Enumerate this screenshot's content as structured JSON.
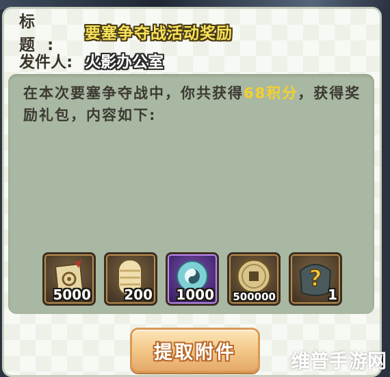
{
  "mail": {
    "title_label": "标题:",
    "title_value": "要塞争夺战活动奖励",
    "sender_label": "发件人:",
    "sender_value": "火影办公室",
    "message_before": "在本次要塞争夺战中，你共获得",
    "message_points": "68积分",
    "message_after": "，获得奖励礼包，内容如下:",
    "points_color": "#f4d12e"
  },
  "rewards": [
    {
      "icon": "scroll-icon",
      "count": "5000"
    },
    {
      "icon": "wrapped-scroll-icon",
      "count": "200"
    },
    {
      "icon": "taiji-orb-icon",
      "count": "1000"
    },
    {
      "icon": "copper-coin-icon",
      "count": "500000"
    },
    {
      "icon": "mystery-bag-icon",
      "count": "1"
    }
  ],
  "actions": {
    "claim_label": "提取附件"
  },
  "watermark": "维普手游网"
}
